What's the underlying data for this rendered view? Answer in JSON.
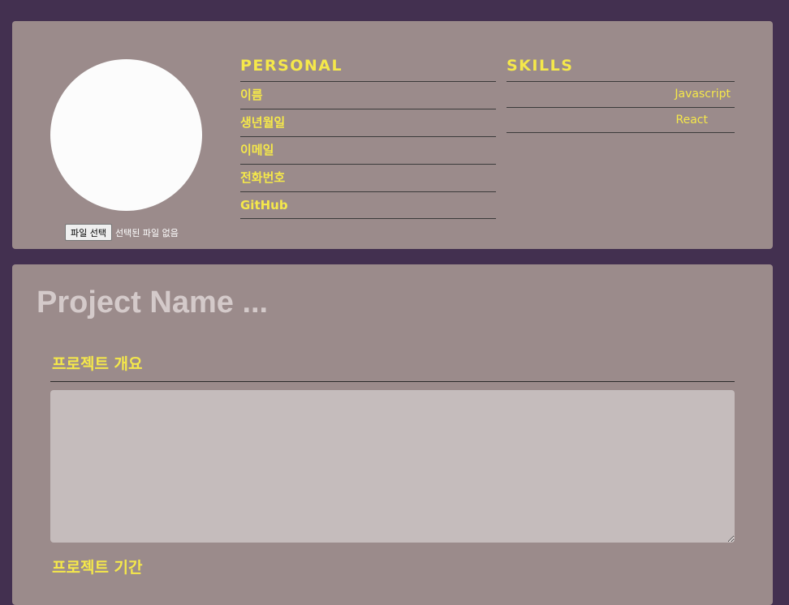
{
  "profile": {
    "file_button_label": "파일 선택",
    "file_status": "선택된 파일 없음",
    "personal": {
      "title": "PERSONAL",
      "items": [
        "이름",
        "생년월일",
        "이메일",
        "전화번호",
        "GitHub"
      ]
    },
    "skills": {
      "title": "SKILLS",
      "items": [
        "Javascript",
        "React"
      ]
    }
  },
  "project": {
    "name_placeholder": "Project Name ...",
    "overview_title": "프로젝트 개요",
    "overview_value": "",
    "period_title": "프로젝트 기간"
  },
  "colors": {
    "background": "#433050",
    "card": "#9b8b8b",
    "accent": "#f5e84a",
    "textarea": "#c5bcbc"
  }
}
